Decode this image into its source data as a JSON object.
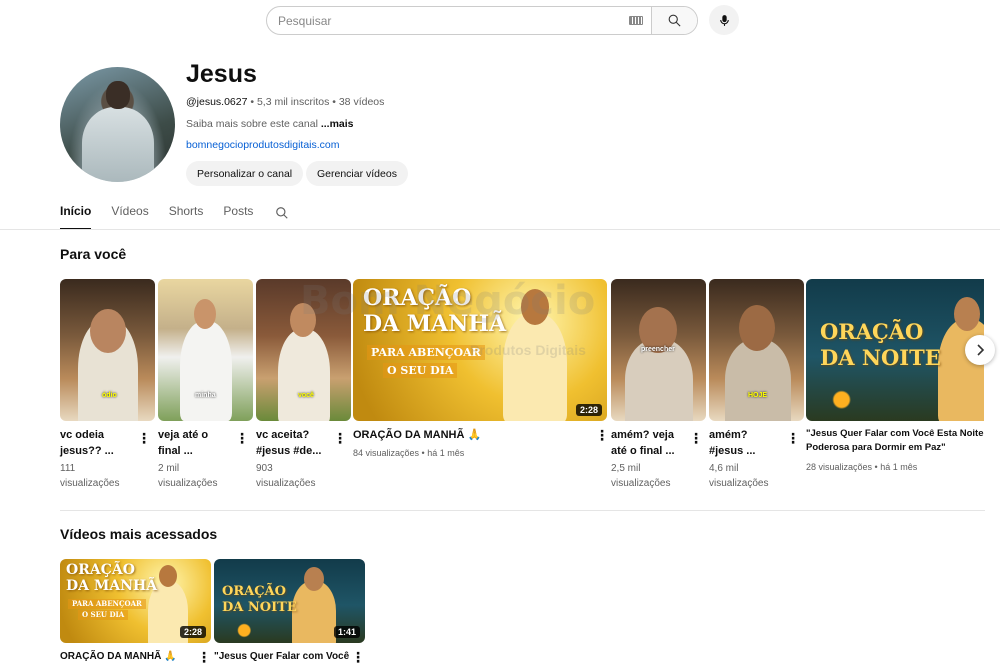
{
  "search": {
    "placeholder": "Pesquisar"
  },
  "channel": {
    "name": "Jesus",
    "handle": "@jesus.0627",
    "subscribers": "5,3 mil inscritos",
    "videos_count": "38 vídeos",
    "about": "Saiba mais sobre este canal",
    "about_more": "...mais",
    "link": "bomnegocioprodutosdigitais.com",
    "customize_label": "Personalizar o canal",
    "manage_label": "Gerenciar vídeos"
  },
  "tabs": [
    "Início",
    "Vídeos",
    "Shorts",
    "Posts"
  ],
  "sections": {
    "for_you": "Para você",
    "most_viewed": "Vídeos mais acessados"
  },
  "for_you": [
    {
      "title1": "vc odeia",
      "title2": "jesus?? ...",
      "views1": "111",
      "views2": "visualizações",
      "caption": "ódio"
    },
    {
      "title1": "veja até o",
      "title2": "final ...",
      "views1": "2 mil",
      "views2": "visualizações",
      "caption": "minha"
    },
    {
      "title1": "vc aceita?",
      "title2": "#jesus #de...",
      "views1": "903",
      "views2": "visualizações",
      "caption": "você"
    },
    {
      "title": "ORAÇÃO DA MANHÃ 🙏",
      "meta": "84 visualizações • há 1 mês",
      "duration": "2:28",
      "big1": "ORAÇÃO",
      "big2": "DA MANHÃ",
      "sub1": "PARA ABENÇOAR",
      "sub2": "O SEU DIA"
    },
    {
      "title1": "amém? veja",
      "title2": "até o final ...",
      "views1": "2,5 mil",
      "views2": "visualizações",
      "caption": "preencher"
    },
    {
      "title1": "amém?",
      "title2": "#jesus ...",
      "views1": "4,6 mil",
      "views2": "visualizações",
      "caption": "HOJE"
    },
    {
      "title1": "\"Jesus Quer Falar com Você Esta Noite",
      "title2": "Poderosa para Dormir em Paz\"",
      "meta": "28 visualizações • há 1 mês",
      "big1": "ORAÇÃO",
      "big2": "DA NOITE"
    }
  ],
  "most_viewed": [
    {
      "title": "ORAÇÃO DA MANHÃ 🙏",
      "duration": "2:28",
      "big1": "ORAÇÃO",
      "big2": "DA MANHÃ",
      "sub1": "PARA ABENÇOAR",
      "sub2": "O SEU DIA"
    },
    {
      "title": "\"Jesus Quer Falar com Você",
      "duration": "1:41",
      "big1": "ORAÇÃO",
      "big2": "DA NOITE"
    }
  ],
  "watermark": {
    "text": "Bom Negócio",
    "sub": "Produtos Digitais"
  },
  "colors": {
    "link": "#065fd4",
    "chip_bg": "#f2f2f2",
    "text_secondary": "#606060"
  },
  "icons": [
    "keyboard-icon",
    "search-icon",
    "mic-icon",
    "chevron-right-icon",
    "more-vert-icon"
  ]
}
